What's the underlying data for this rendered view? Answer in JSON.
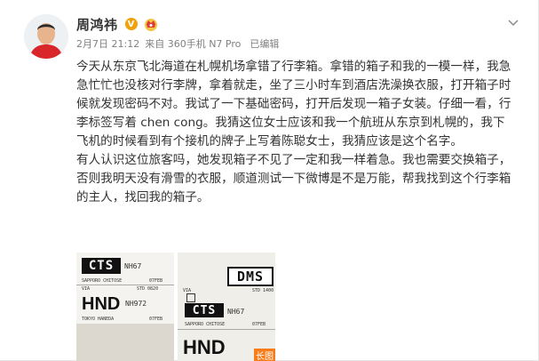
{
  "user": {
    "name": "周鸿祎",
    "verified_badge": "V",
    "verified_color": "#f0a20a",
    "member_icon": "crown-member-icon"
  },
  "post": {
    "date": "2月7日 21:12",
    "source": "来自 360手机 N7 Pro",
    "edited": "已编辑",
    "paragraph1": "今天从东京飞北海道在札幌机场拿错了行李箱。拿错的箱子和我的一模一样，我急急忙忙也没核对行李牌，拿着就走，坐了三小时车到酒店洗澡换衣服，打开箱子时候就发现密码不对。我试了一下基础密码，打开后发现一箱子女装。仔细一看，行李标签写着 chen cong。我猜这位女士应该和我一个航班从东京到札幌的，我下飞机的时候看到有个接机的牌子上写着陈聪女士，我猜应该是这个名字。",
    "paragraph2": "有人认识这位旅客吗，她发现箱子不见了一定和我一样着急。我也需要交换箱子，否则我明天没有滑雪的衣服，顺道测试一下微博是不是万能，帮我找到这个行李箱的主人，找回我的箱子。"
  },
  "photos": {
    "photo1": {
      "top_code": "CTS",
      "top_suffix": "NH67",
      "line1": "SAPPORO CHITOSE",
      "line1_right": "07FEB",
      "via": "VIA",
      "std": "STD 0820",
      "big_code": "HND",
      "big_suffix": "NH972",
      "line2": "TOKYO HANEDA",
      "line2_right": "07FEB"
    },
    "photo2": {
      "top_code": "DMS",
      "std": "STD 1400",
      "via": "VIA",
      "mid_code": "CTS",
      "mid_suffix": "NH67",
      "line1": "SAPPORO CHITOSE",
      "line1_right": "07FEB",
      "big_code": "HND",
      "long_label": "长图",
      "long_color": "#f87c1a"
    }
  }
}
